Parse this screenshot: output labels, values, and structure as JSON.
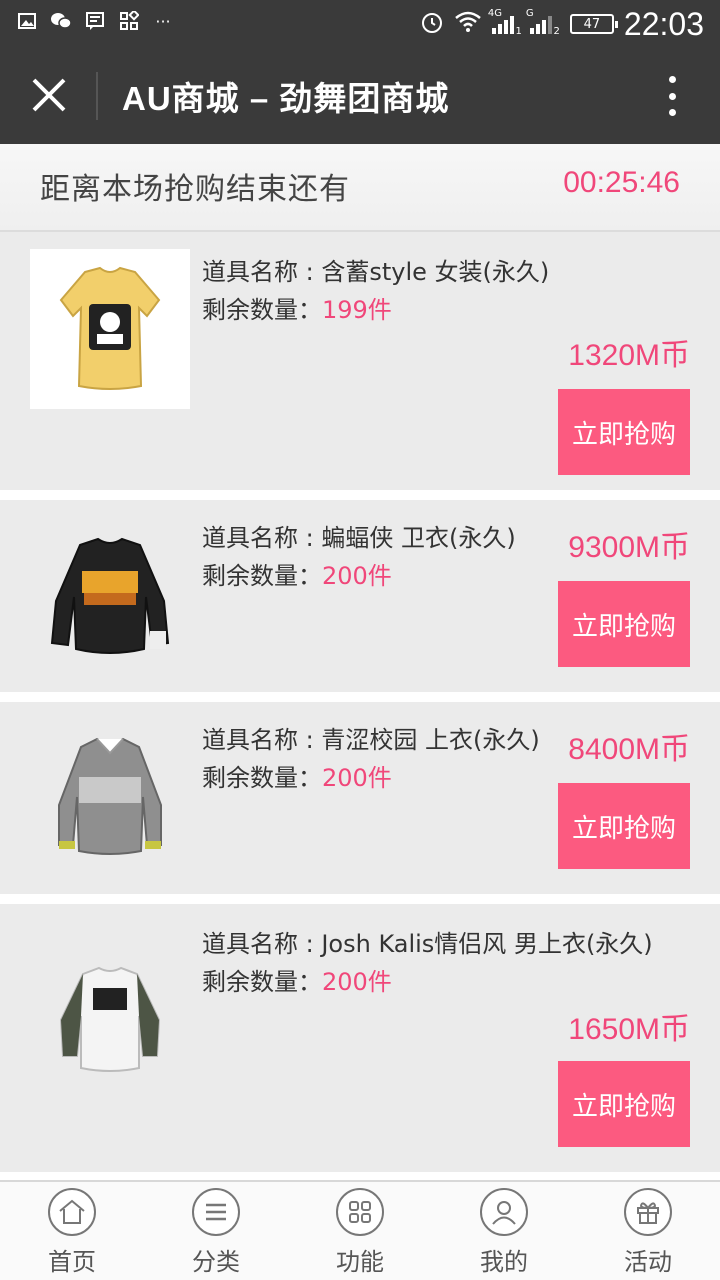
{
  "status_bar": {
    "time": "22:03",
    "battery": "47",
    "net1": "4G",
    "net2": "G",
    "sim1": "1",
    "sim2": "2",
    "more": "···"
  },
  "titlebar": {
    "title": "AU商城 – 劲舞团商城"
  },
  "countdown": {
    "label": "距离本场抢购结束还有",
    "time": "00:25:46"
  },
  "products": [
    {
      "name": "道具名称 : 含蓄style 女装(永久)",
      "qty_label": "剩余数量：",
      "qty": "199件",
      "price": "1320M币",
      "button": "立即抢购",
      "image": "yellow-tshirt"
    },
    {
      "name": "道具名称 : 蝙蝠侠 卫衣(永久)",
      "qty_label": "剩余数量：",
      "qty": "200件",
      "price": "9300M币",
      "button": "立即抢购",
      "image": "black-sweatshirt"
    },
    {
      "name": "道具名称 : 青涩校园 上衣(永久)",
      "qty_label": "剩余数量：",
      "qty": "200件",
      "price": "8400M币",
      "button": "立即抢购",
      "image": "gray-sweater"
    },
    {
      "name": "道具名称 : Josh Kalis情侣风 男上衣(永久)",
      "qty_label": "剩余数量：",
      "qty": "200件",
      "price": "1650M币",
      "button": "立即抢购",
      "image": "white-raglan-shirt"
    }
  ],
  "bottom_nav": [
    {
      "label": "首页",
      "icon": "home-icon"
    },
    {
      "label": "分类",
      "icon": "menu-icon"
    },
    {
      "label": "功能",
      "icon": "grid-icon"
    },
    {
      "label": "我的",
      "icon": "user-icon"
    },
    {
      "label": "活动",
      "icon": "gift-icon"
    }
  ],
  "colors": {
    "accent": "#f0477a",
    "button": "#fc5a80",
    "header": "#3a3a3a",
    "card": "#ebebeb"
  }
}
